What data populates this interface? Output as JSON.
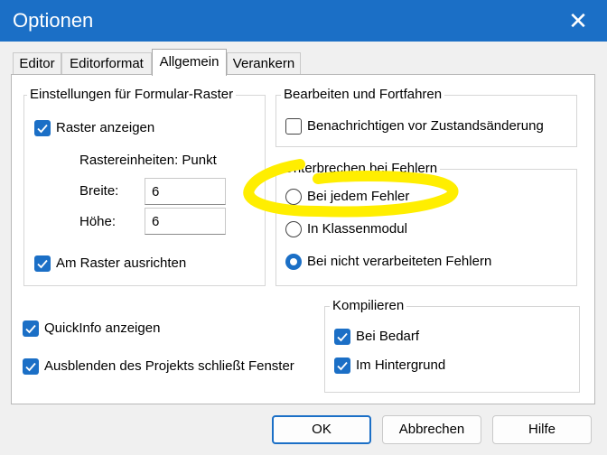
{
  "window": {
    "title": "Optionen",
    "close_icon": "close-icon"
  },
  "tabs": [
    {
      "label": "Editor",
      "active": false
    },
    {
      "label": "Editorformat",
      "active": false
    },
    {
      "label": "Allgemein",
      "active": true
    },
    {
      "label": "Verankern",
      "active": false
    }
  ],
  "grid_settings": {
    "legend": "Einstellungen für Formular-Raster",
    "show_grid": {
      "label": "Raster anzeigen",
      "checked": true
    },
    "units_label": "Rastereinheiten: Punkt",
    "width": {
      "label": "Breite:",
      "value": "6"
    },
    "height": {
      "label": "Höhe:",
      "value": "6"
    },
    "align": {
      "label": "Am Raster ausrichten",
      "checked": true
    }
  },
  "edit_continue": {
    "legend": "Bearbeiten und Fortfahren",
    "notify": {
      "label": "Benachrichtigen vor Zustandsänderung",
      "checked": false
    }
  },
  "error_trapping": {
    "legend": "Unterbrechen bei Fehlern",
    "options": [
      {
        "label": "Bei jedem Fehler",
        "selected": false
      },
      {
        "label": "In Klassenmodul",
        "selected": false
      },
      {
        "label": "Bei nicht verarbeiteten Fehlern",
        "selected": true
      }
    ]
  },
  "misc": {
    "quickinfo": {
      "label": "QuickInfo anzeigen",
      "checked": true
    },
    "collapse": {
      "label": "Ausblenden des Projekts schließt Fenster",
      "checked": true
    }
  },
  "compile": {
    "legend": "Kompilieren",
    "on_demand": {
      "label": "Bei Bedarf",
      "checked": true
    },
    "background": {
      "label": "Im Hintergrund",
      "checked": true
    }
  },
  "buttons": {
    "ok": "OK",
    "cancel": "Abbrechen",
    "help": "Hilfe"
  },
  "annotation": {
    "color": "#ffee00",
    "icon": "highlight-scribble"
  },
  "colors": {
    "accent": "#1b6fc6"
  }
}
